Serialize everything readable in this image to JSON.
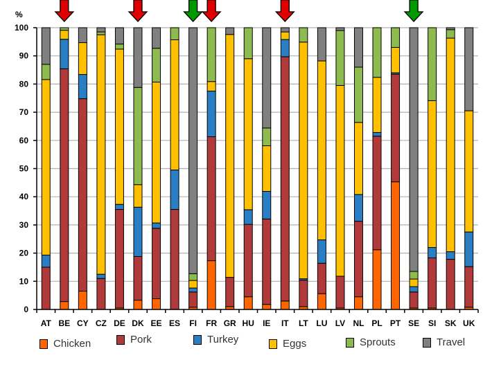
{
  "chart_data": {
    "type": "bar",
    "stacked": true,
    "title": "",
    "ylabel": "%",
    "xlabel": "",
    "ylim": [
      0,
      100
    ],
    "yticks": [
      0,
      10,
      20,
      30,
      40,
      50,
      60,
      70,
      80,
      90,
      100
    ],
    "grid": true,
    "legend_position": "bottom",
    "categories": [
      "AT",
      "BE",
      "CY",
      "CZ",
      "DE",
      "DK",
      "EE",
      "ES",
      "FI",
      "FR",
      "GR",
      "HU",
      "IE",
      "IT",
      "LT",
      "LU",
      "LV",
      "NL",
      "PL",
      "PT",
      "SE",
      "SI",
      "SK",
      "UK"
    ],
    "series": [
      {
        "name": "Chicken",
        "color": "#ff6600",
        "values": [
          0,
          2.8,
          6.5,
          0,
          0.5,
          3.3,
          3.8,
          0,
          0.8,
          17.3,
          1,
          4.5,
          1.8,
          3,
          1,
          5.6,
          0.5,
          4.5,
          21.2,
          45.3,
          0.5,
          0.5,
          0,
          0.8
        ]
      },
      {
        "name": "Pork",
        "color": "#b03a3a",
        "values": [
          15,
          82.6,
          68.3,
          11,
          35,
          15.5,
          25,
          35.5,
          5.4,
          44,
          10.4,
          25.7,
          30.3,
          86.7,
          9.4,
          10.8,
          11.3,
          26.8,
          40.3,
          38.2,
          5.7,
          17.8,
          17.8,
          14.4
        ]
      },
      {
        "name": "Turkey",
        "color": "#2a7fc4",
        "values": [
          4.3,
          10.5,
          8.6,
          1.5,
          1.8,
          17.5,
          1.9,
          14,
          1.4,
          16.2,
          0,
          5.2,
          9.8,
          6.1,
          0.5,
          8.3,
          0,
          9.5,
          1.3,
          0.5,
          1.9,
          3.7,
          2.7,
          12.3
        ]
      },
      {
        "name": "Eggs",
        "color": "#ffc000",
        "values": [
          62.3,
          3.2,
          11.3,
          85,
          55.1,
          8,
          50,
          46.2,
          2.7,
          3.4,
          86.2,
          53.6,
          16.2,
          2.7,
          84,
          63.5,
          67.7,
          25.6,
          19.6,
          9,
          2.7,
          52.1,
          75.8,
          43
        ]
      },
      {
        "name": "Sprouts",
        "color": "#8dbb4f",
        "values": [
          5.4,
          0.9,
          0,
          1,
          1.8,
          34.5,
          12,
          4.3,
          2.4,
          19.1,
          0,
          11,
          6.3,
          0,
          5.1,
          0,
          19.5,
          19.6,
          17.6,
          7,
          2.7,
          25.9,
          3,
          0
        ]
      },
      {
        "name": "Travel",
        "color": "#808080",
        "values": [
          13,
          0,
          5.3,
          1.5,
          5.8,
          21.2,
          7.3,
          0,
          87.3,
          0,
          2.4,
          0,
          35.6,
          1.5,
          0,
          11.8,
          1,
          14,
          0,
          0,
          86.5,
          0,
          0.7,
          29.5
        ]
      }
    ],
    "annotations": [
      {
        "type": "arrow-down",
        "category": "BE",
        "color": "red"
      },
      {
        "type": "arrow-down",
        "category": "DK",
        "color": "red"
      },
      {
        "type": "arrow-down",
        "category": "FI",
        "color": "green"
      },
      {
        "type": "arrow-down",
        "category": "FR",
        "color": "red"
      },
      {
        "type": "arrow-down",
        "category": "IT",
        "color": "red"
      },
      {
        "type": "arrow-down",
        "category": "SE",
        "color": "green"
      }
    ],
    "arrow_colors": {
      "red": "#e00000",
      "green": "#009a00"
    }
  }
}
